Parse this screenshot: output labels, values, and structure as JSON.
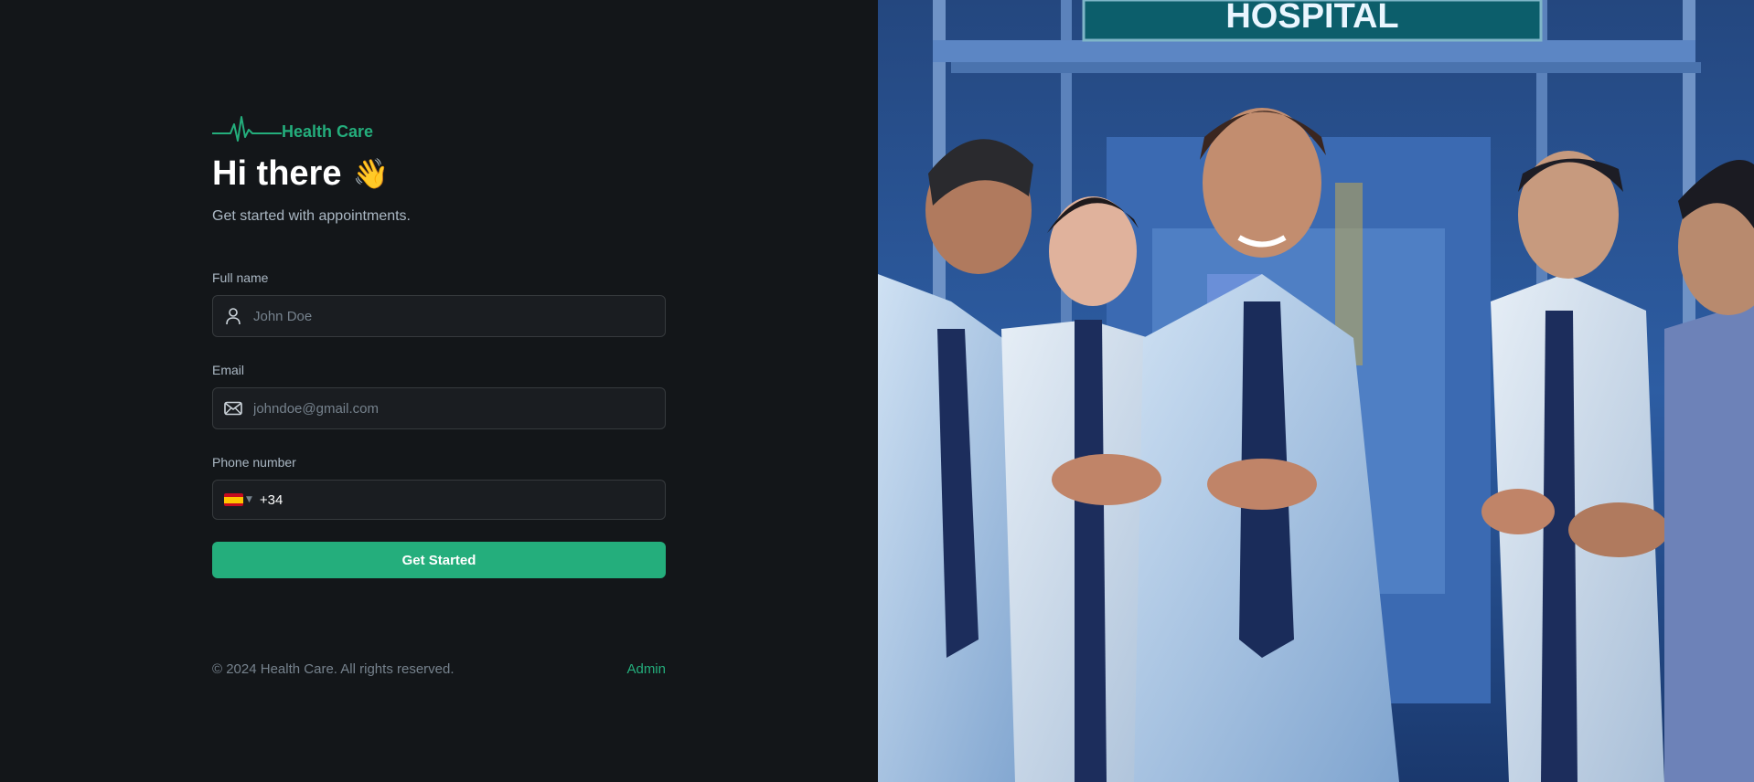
{
  "brand": {
    "logo_text": "Health Care",
    "accent_color": "#24ae7c",
    "logo_icon": "heartbeat-icon"
  },
  "hero": {
    "greeting": "Hi there",
    "wave_emoji": "👋",
    "subtitle": "Get started with appointments."
  },
  "form": {
    "full_name": {
      "label": "Full name",
      "placeholder": "John Doe",
      "icon": "user-icon"
    },
    "email": {
      "label": "Email",
      "placeholder": "johndoe@gmail.com",
      "icon": "mail-icon"
    },
    "phone": {
      "label": "Phone number",
      "value": "+34",
      "country_flag": "flag-es-icon"
    },
    "submit_label": "Get Started"
  },
  "footer": {
    "copyright": "© 2024 Health Care. All rights reserved.",
    "admin_link": "Admin"
  },
  "illustration": {
    "sign_text": "HOSPITAL",
    "colors": {
      "sky": "#1f3f73",
      "sign": "#0c5e6b",
      "coat": "#d9e4ef"
    }
  }
}
